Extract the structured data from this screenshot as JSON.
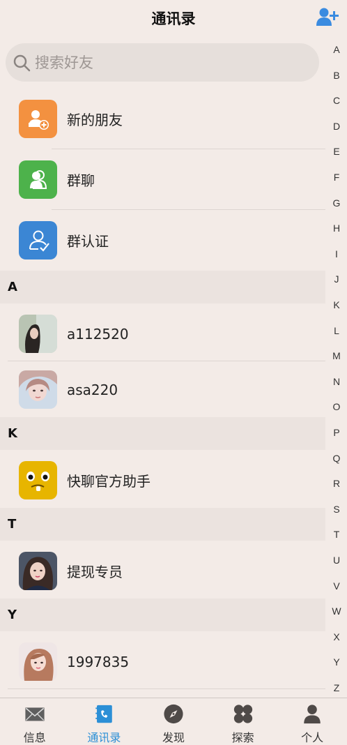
{
  "header": {
    "title": "通讯录"
  },
  "search": {
    "placeholder": "搜索好友"
  },
  "functions": [
    {
      "label": "新的朋友",
      "color": "#f39140",
      "icon": "add-friend-icon"
    },
    {
      "label": "群聊",
      "color": "#4db24b",
      "icon": "group-chat-icon"
    },
    {
      "label": "群认证",
      "color": "#3b86d4",
      "icon": "group-verify-icon"
    }
  ],
  "sections": [
    {
      "letter": "A",
      "contacts": [
        {
          "name": "a112520"
        },
        {
          "name": "asa220"
        }
      ]
    },
    {
      "letter": "K",
      "contacts": [
        {
          "name": "快聊官方助手"
        }
      ]
    },
    {
      "letter": "T",
      "contacts": [
        {
          "name": "提现专员"
        }
      ]
    },
    {
      "letter": "Y",
      "contacts": [
        {
          "name": "1997835"
        }
      ]
    }
  ],
  "index_letters": [
    "A",
    "B",
    "C",
    "D",
    "E",
    "F",
    "G",
    "H",
    "I",
    "J",
    "K",
    "L",
    "M",
    "N",
    "O",
    "P",
    "Q",
    "R",
    "S",
    "T",
    "U",
    "V",
    "W",
    "X",
    "Y",
    "Z"
  ],
  "tabs": [
    {
      "label": "信息",
      "icon": "mail-icon"
    },
    {
      "label": "通讯录",
      "icon": "contacts-book-icon",
      "active": true
    },
    {
      "label": "发现",
      "icon": "compass-icon"
    },
    {
      "label": "探索",
      "icon": "clover-icon"
    },
    {
      "label": "个人",
      "icon": "person-icon"
    }
  ],
  "colors": {
    "accent": "#2b8fd6",
    "background": "#f3ebe7",
    "section": "#ebe3df"
  }
}
